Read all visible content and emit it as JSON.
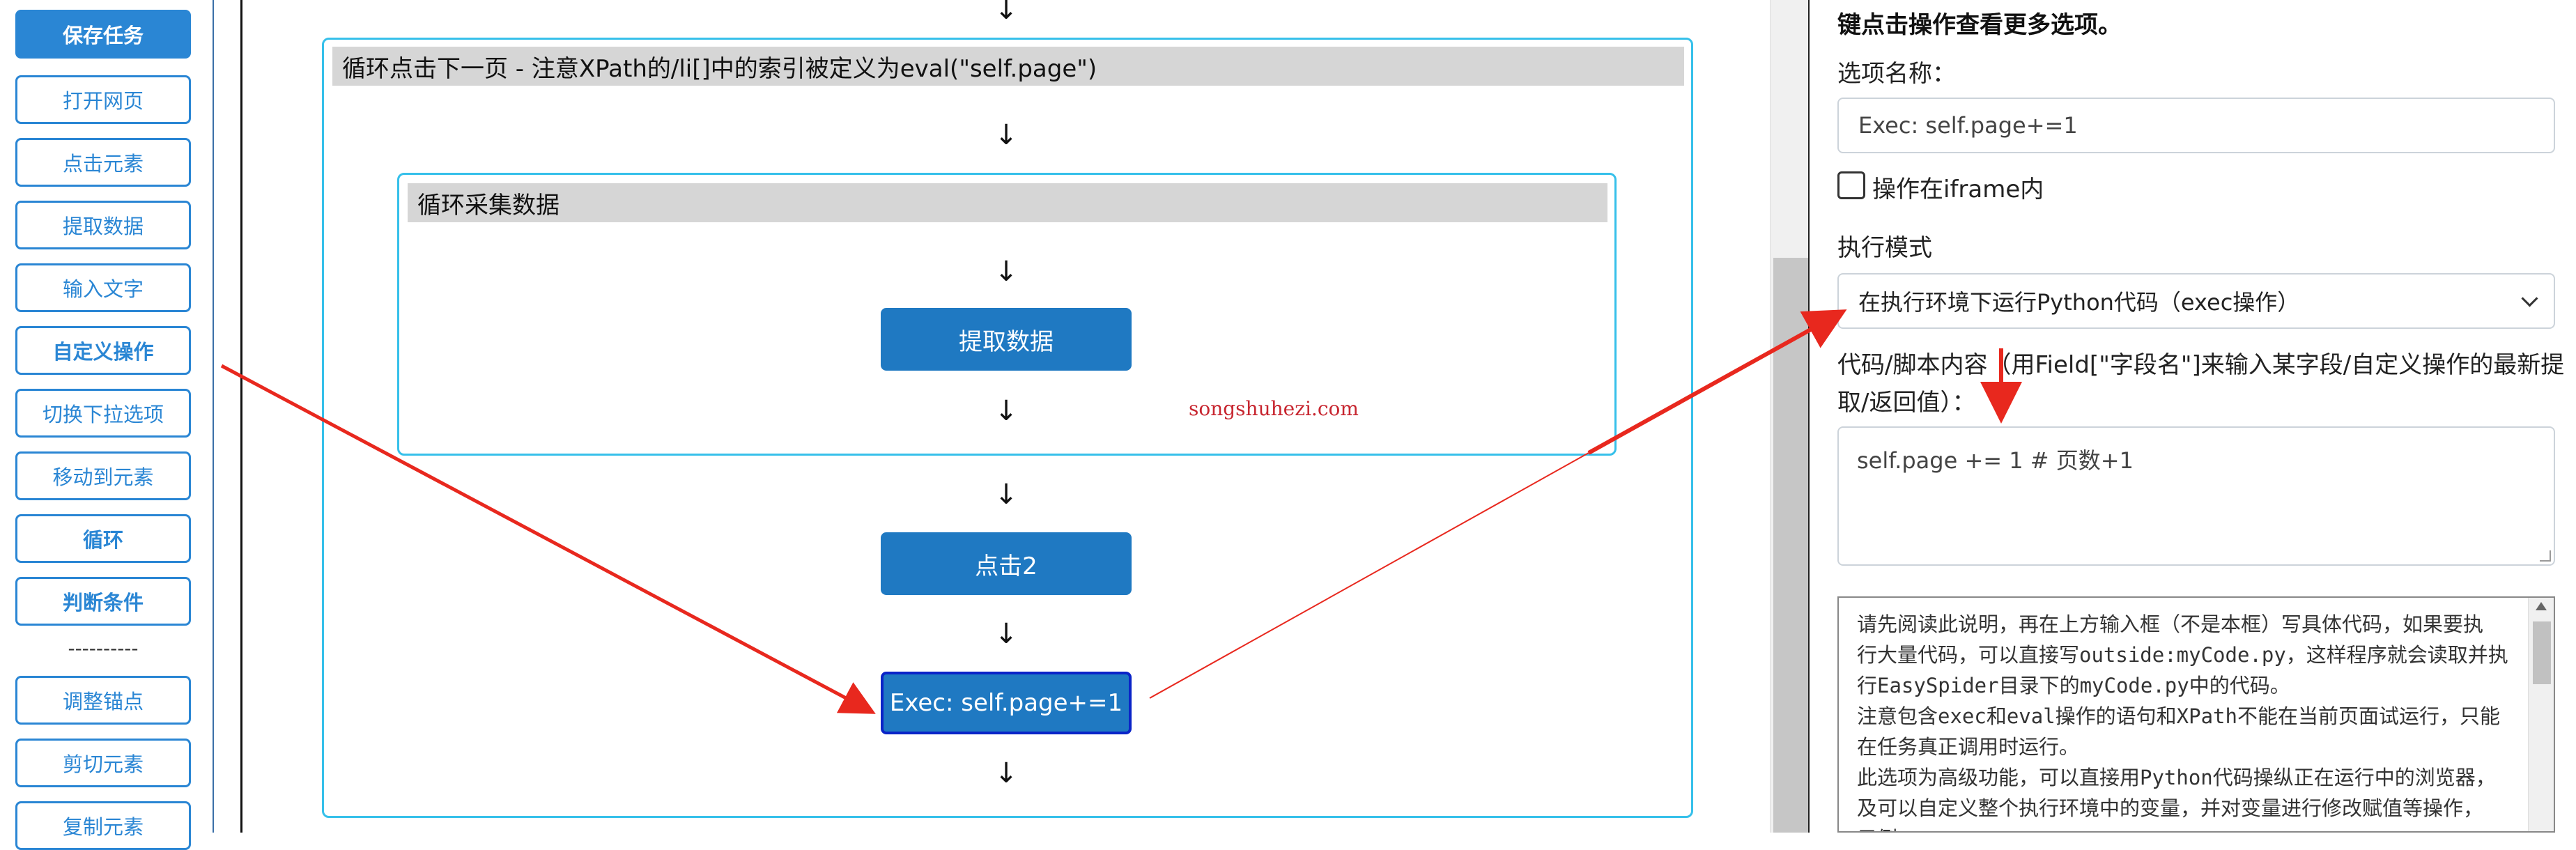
{
  "sidebar": {
    "buttons": [
      {
        "label": "保存任务"
      },
      {
        "label": "打开网页"
      },
      {
        "label": "点击元素"
      },
      {
        "label": "提取数据"
      },
      {
        "label": "输入文字"
      },
      {
        "label": "自定义操作"
      },
      {
        "label": "切换下拉选项"
      },
      {
        "label": "移动到元素"
      },
      {
        "label": "循环"
      },
      {
        "label": "判断条件"
      },
      {
        "label": "调整锚点"
      },
      {
        "label": "剪切元素"
      },
      {
        "label": "复制元素"
      }
    ],
    "separator": "----------"
  },
  "flow": {
    "top_arrow": "↓",
    "outer_loop_title": "循环点击下一页 - 注意XPath的/li[]中的索引被定义为eval(\"self.page\")",
    "inner_loop_title": "循环采集数据",
    "extract_node": "提取数据",
    "click_node": "点击2",
    "exec_node": "Exec: self.page+=1",
    "arrow": "↓",
    "watermark": "songshuhezi.com"
  },
  "panel": {
    "hint_text": "键点击操作查看更多选项。",
    "option_name_label": "选项名称：",
    "option_name_value": "Exec: self.page+=1",
    "iframe_label": "操作在iframe内",
    "exec_mode_label": "执行模式",
    "exec_mode_value": "在执行环境下运行Python代码（exec操作）",
    "code_label_line1": "代码/脚本内容（用Field[\"字段名\"]来输入某字段/自定义操作的最新提",
    "code_label_line2": "取/返回值）：",
    "code_value": "self.page += 1 # 页数+1",
    "help_lines": [
      "请先阅读此说明，再在上方输入框（不是本框）写具体代码，如果要执",
      "行大量代码，可以直接写outside:myCode.py，这样程序就会读取并执",
      "行EasySpider目录下的myCode.py中的代码。",
      "注意包含exec和eval操作的语句和XPath不能在当前页面试运行，只能",
      "在任务真正调用时运行。",
      "此选项为高级功能，可以直接用Python代码操纵正在运行中的浏览器，",
      "及可以自定义整个执行环境中的变量，并对变量进行修改赋值等操作，",
      "示例："
    ]
  },
  "colors": {
    "accent": "#2a86d4",
    "node": "#1f79c2",
    "loop_border": "#36c0ea",
    "annotation": "#e8281e"
  }
}
